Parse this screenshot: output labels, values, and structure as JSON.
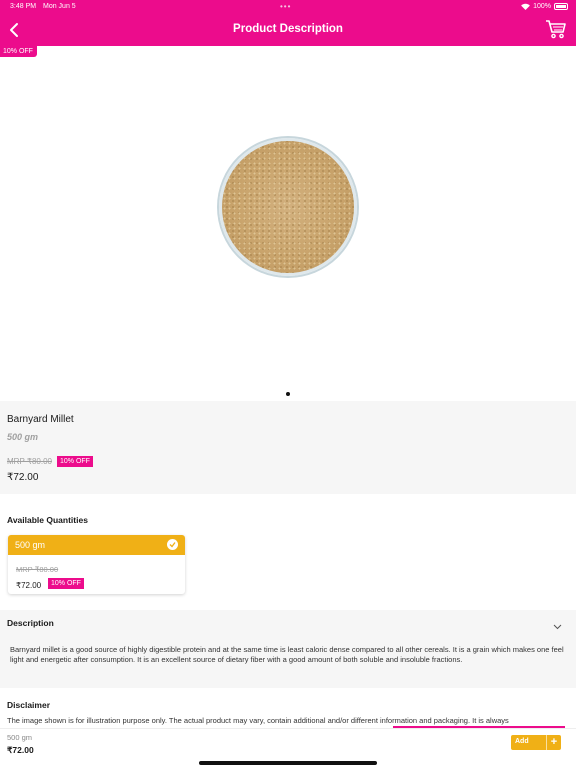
{
  "status_bar": {
    "time": "3:48 PM",
    "date": "Mon Jun 5",
    "battery": "100%"
  },
  "header": {
    "title": "Product Description",
    "back_icon": "chevron-left-icon",
    "cart_icon": "cart-icon"
  },
  "hero": {
    "discount_badge": "10% OFF"
  },
  "product": {
    "name": "Barnyard Millet",
    "weight": "500 gm",
    "mrp": "MRP ₹80.00",
    "discount": "10% OFF",
    "price": "₹72.00"
  },
  "quantities": {
    "title": "Available Quantities",
    "options": [
      {
        "label": "500 gm",
        "mrp": "MRP ₹80.00",
        "price": "₹72.00",
        "discount": "10% OFF",
        "selected": true
      }
    ]
  },
  "description": {
    "title": "Description",
    "text": "Barnyard millet is a good source of highly digestible protein and at the same time is least caloric dense compared to all other cereals. It is a grain which makes one feel light and energetic after consumption. It is an excellent source of dietary fiber with a good amount of both soluble and insoluble fractions."
  },
  "disclaimer": {
    "title": "Disclaimer",
    "text": "The image shown is for illustration purpose only. The actual product may vary, contain additional and/or different information and packaging. It is always"
  },
  "bottom_bar": {
    "weight": "500 gm",
    "price": "₹72.00",
    "add_label": "Add",
    "plus": "+"
  },
  "colors": {
    "brand": "#ec0c8c",
    "accent": "#f0b016"
  }
}
